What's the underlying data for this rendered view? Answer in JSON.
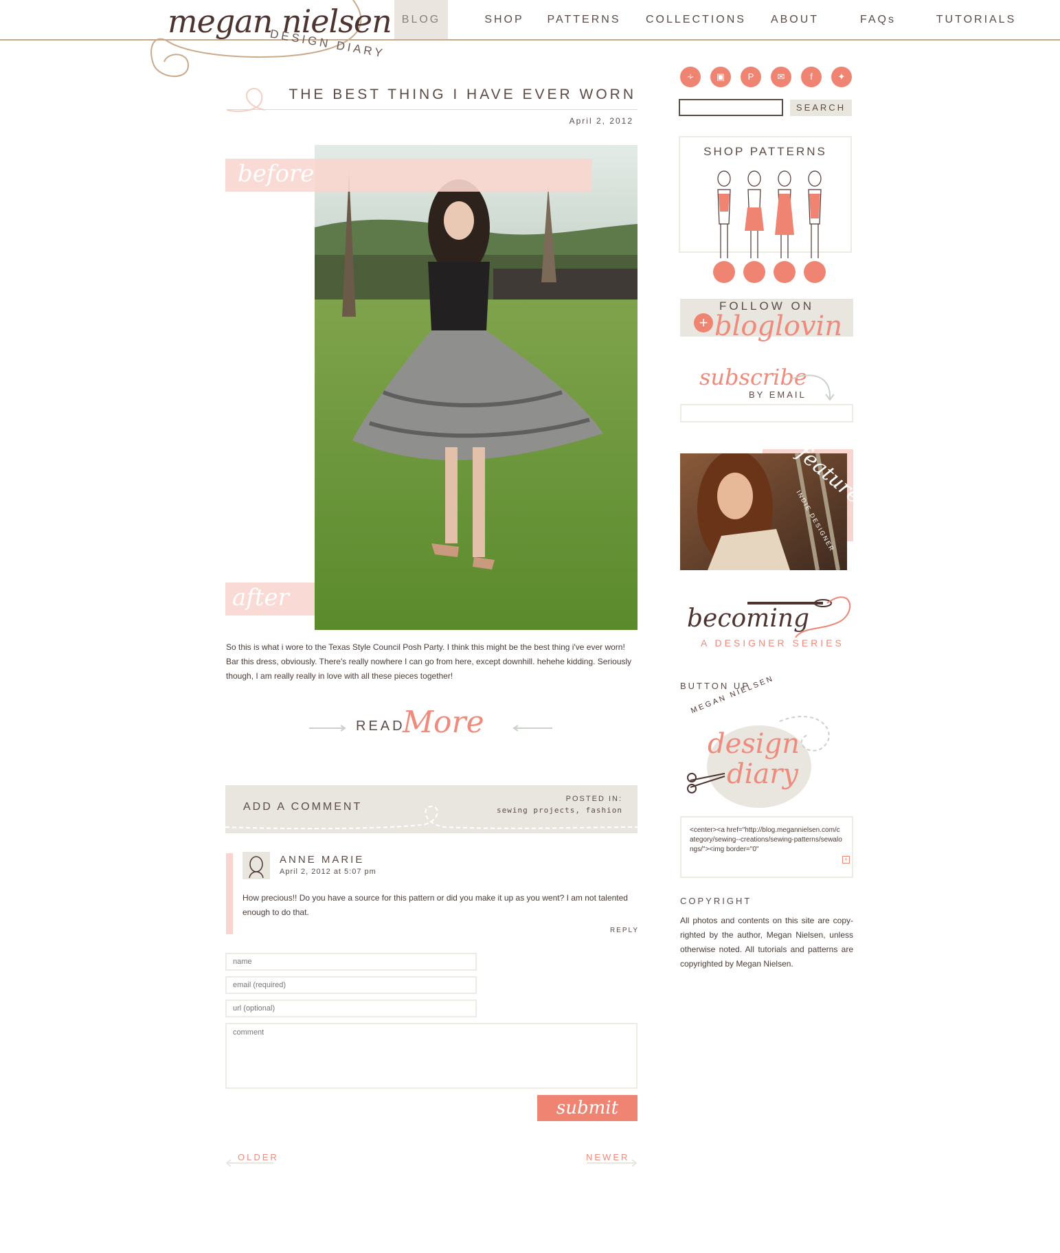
{
  "header": {
    "logo_main": "megan nielsen",
    "logo_sub": "DESIGN DIARY",
    "nav": [
      {
        "label": "BLOG",
        "active": true
      },
      {
        "label": "SHOP",
        "active": false
      },
      {
        "label": "PATTERNS",
        "active": false
      },
      {
        "label": "COLLECTIONS",
        "active": false
      },
      {
        "label": "ABOUT",
        "active": false
      },
      {
        "label": "FAQs",
        "active": false
      },
      {
        "label": "TUTORIALS",
        "active": false
      }
    ]
  },
  "post": {
    "title": "THE BEST THING I HAVE EVER WORN",
    "date": "April 2, 2012",
    "photo_labels": {
      "before": "before",
      "after": "after"
    },
    "body": "So this is what i wore to the Texas Style Council Posh Party. I think this might be the best thing i've ever worn!  Bar this dress, obviously. There's really nowhere I can go from here, except downhill. hehehe kidding. Seriously though, I am really really in love with all these pieces together!",
    "read_more": {
      "read": "READ",
      "more": "More"
    },
    "comment_bar": {
      "add_comment": "ADD A COMMENT",
      "posted_in_label": "POSTED IN:",
      "categories": "sewing projects, fashion"
    }
  },
  "comments": [
    {
      "author": "ANNE MARIE",
      "date": "April 2, 2012 at 5:07 pm",
      "text": "How precious!! Do you have a source for this pattern or did you make it up as you went? I am not talented enough to do that.",
      "reply_label": "REPLY"
    }
  ],
  "comment_form": {
    "name_placeholder": "name",
    "email_placeholder": "email (required)",
    "url_placeholder": "url (optional)",
    "comment_placeholder": "comment",
    "submit_label": "submit"
  },
  "pagination": {
    "older": "OLDER",
    "newer": "NEWER"
  },
  "sidebar": {
    "social_icons": [
      "rss-icon",
      "instagram-icon",
      "pinterest-icon",
      "mail-icon",
      "facebook-icon",
      "twitter-icon"
    ],
    "search_label": "SEARCH",
    "shop_patterns": "SHOP PATTERNS",
    "follow_on": "FOLLOW ON",
    "bloglovin": "bloglovin",
    "subscribe": "subscribe",
    "by_email": "BY EMAIL",
    "featured": "featured",
    "featured_sub": "INDIE DESIGNER",
    "becoming": "becoming",
    "designer_series": "A DESIGNER SERIES",
    "button_up": "BUTTON UP",
    "badge_top": "MEGAN NIELSEN",
    "badge_word_1": "design",
    "badge_word_2": "diary",
    "button_code": "<center><a href=\"http://blog.megannielsen.com/category/sewing--creations/sewing-patterns/sewalongs/\"><img border=\"0\"",
    "copyright_title": "COPYRIGHT",
    "copyright_text": "All photos and contents on this site are copy-righted by the author, Megan Nielsen, unless otherwise noted. All tutorials and patterns are copyrighted by Megan Nielsen."
  },
  "colors": {
    "accent": "#ef8472",
    "blush": "#f8d6cf",
    "beige": "#e9e6df",
    "text": "#4a3a36",
    "rule": "#c9a98a"
  }
}
